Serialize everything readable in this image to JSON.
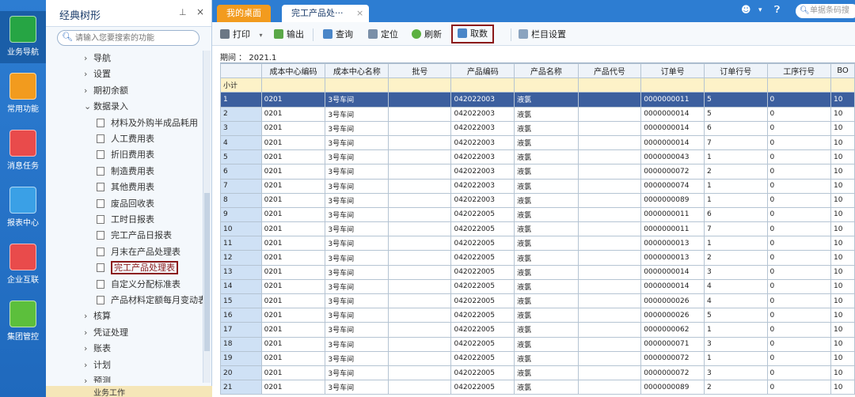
{
  "rail": [
    {
      "label": "业务导航",
      "icon": "nav-grid-icon",
      "color": "#26a544",
      "active": true
    },
    {
      "label": "常用功能",
      "icon": "star-icon",
      "color": "#f29b1e"
    },
    {
      "label": "消息任务",
      "icon": "message-icon",
      "color": "#e94b4b"
    },
    {
      "label": "报表中心",
      "icon": "report-icon",
      "color": "#3aa0e6"
    },
    {
      "label": "企业互联",
      "icon": "connect-icon",
      "color": "#e94b4b"
    },
    {
      "label": "集团管控",
      "icon": "group-icon",
      "color": "#5cbf3c"
    }
  ],
  "tree": {
    "title": "经典树形",
    "search_placeholder": "请输入您要搜索的功能",
    "items": [
      {
        "label": "导航",
        "level": 1,
        "arrow": "›"
      },
      {
        "label": "设置",
        "level": 1,
        "arrow": "›"
      },
      {
        "label": "期初余额",
        "level": 1,
        "arrow": "›"
      },
      {
        "label": "数据录入",
        "level": 1,
        "arrow": "⌄"
      },
      {
        "label": "材料及外购半成品耗用",
        "level": 2
      },
      {
        "label": "人工费用表",
        "level": 2
      },
      {
        "label": "折旧费用表",
        "level": 2
      },
      {
        "label": "制造费用表",
        "level": 2
      },
      {
        "label": "其他费用表",
        "level": 2
      },
      {
        "label": "废品回收表",
        "level": 2
      },
      {
        "label": "工时日报表",
        "level": 2
      },
      {
        "label": "完工产品日报表",
        "level": 2
      },
      {
        "label": "月末在产品处理表",
        "level": 2
      },
      {
        "label": "完工产品处理表",
        "level": 2,
        "selected": true
      },
      {
        "label": "自定义分配标准表",
        "level": 2
      },
      {
        "label": "产品材料定额每月变动表",
        "level": 2
      },
      {
        "label": "核算",
        "level": 1,
        "arrow": "›"
      },
      {
        "label": "凭证处理",
        "level": 1,
        "arrow": "›"
      },
      {
        "label": "账表",
        "level": 1,
        "arrow": "›"
      },
      {
        "label": "计划",
        "level": 1,
        "arrow": "›"
      },
      {
        "label": "预测",
        "level": 1,
        "arrow": "›"
      }
    ],
    "footer": "业务工作"
  },
  "tabs": {
    "home": "我的桌面",
    "current": "完工产品处···",
    "close": "×"
  },
  "top_search_placeholder": "单据条码搜",
  "toolbar": {
    "print": "打印",
    "export": "输出",
    "query": "查询",
    "locate": "定位",
    "refresh": "刷新",
    "fetch": "取数",
    "columns": "栏目设置"
  },
  "period": {
    "label": "期间",
    "value": "2021.1"
  },
  "grid": {
    "headers": [
      "成本中心编码",
      "成本中心名称",
      "批号",
      "产品编码",
      "产品名称",
      "产品代号",
      "订单号",
      "订单行号",
      "工序行号",
      "BO"
    ],
    "subtotal": "小计",
    "rows": [
      [
        "1",
        "0201",
        "3号车间",
        "",
        "042022003",
        "液氯",
        "",
        "0000000011",
        "5",
        "0",
        "10"
      ],
      [
        "2",
        "0201",
        "3号车间",
        "",
        "042022003",
        "液氯",
        "",
        "0000000014",
        "5",
        "0",
        "10"
      ],
      [
        "3",
        "0201",
        "3号车间",
        "",
        "042022003",
        "液氯",
        "",
        "0000000014",
        "6",
        "0",
        "10"
      ],
      [
        "4",
        "0201",
        "3号车间",
        "",
        "042022003",
        "液氯",
        "",
        "0000000014",
        "7",
        "0",
        "10"
      ],
      [
        "5",
        "0201",
        "3号车间",
        "",
        "042022003",
        "液氯",
        "",
        "0000000043",
        "1",
        "0",
        "10"
      ],
      [
        "6",
        "0201",
        "3号车间",
        "",
        "042022003",
        "液氯",
        "",
        "0000000072",
        "2",
        "0",
        "10"
      ],
      [
        "7",
        "0201",
        "3号车间",
        "",
        "042022003",
        "液氯",
        "",
        "0000000074",
        "1",
        "0",
        "10"
      ],
      [
        "8",
        "0201",
        "3号车间",
        "",
        "042022003",
        "液氯",
        "",
        "0000000089",
        "1",
        "0",
        "10"
      ],
      [
        "9",
        "0201",
        "3号车间",
        "",
        "042022005",
        "液氯",
        "",
        "0000000011",
        "6",
        "0",
        "10"
      ],
      [
        "10",
        "0201",
        "3号车间",
        "",
        "042022005",
        "液氯",
        "",
        "0000000011",
        "7",
        "0",
        "10"
      ],
      [
        "11",
        "0201",
        "3号车间",
        "",
        "042022005",
        "液氯",
        "",
        "0000000013",
        "1",
        "0",
        "10"
      ],
      [
        "12",
        "0201",
        "3号车间",
        "",
        "042022005",
        "液氯",
        "",
        "0000000013",
        "2",
        "0",
        "10"
      ],
      [
        "13",
        "0201",
        "3号车间",
        "",
        "042022005",
        "液氯",
        "",
        "0000000014",
        "3",
        "0",
        "10"
      ],
      [
        "14",
        "0201",
        "3号车间",
        "",
        "042022005",
        "液氯",
        "",
        "0000000014",
        "4",
        "0",
        "10"
      ],
      [
        "15",
        "0201",
        "3号车间",
        "",
        "042022005",
        "液氯",
        "",
        "0000000026",
        "4",
        "0",
        "10"
      ],
      [
        "16",
        "0201",
        "3号车间",
        "",
        "042022005",
        "液氯",
        "",
        "0000000026",
        "5",
        "0",
        "10"
      ],
      [
        "17",
        "0201",
        "3号车间",
        "",
        "042022005",
        "液氯",
        "",
        "0000000062",
        "1",
        "0",
        "10"
      ],
      [
        "18",
        "0201",
        "3号车间",
        "",
        "042022005",
        "液氯",
        "",
        "0000000071",
        "3",
        "0",
        "10"
      ],
      [
        "19",
        "0201",
        "3号车间",
        "",
        "042022005",
        "液氯",
        "",
        "0000000072",
        "1",
        "0",
        "10"
      ],
      [
        "20",
        "0201",
        "3号车间",
        "",
        "042022005",
        "液氯",
        "",
        "0000000072",
        "3",
        "0",
        "10"
      ],
      [
        "21",
        "0201",
        "3号车间",
        "",
        "042022005",
        "液氯",
        "",
        "0000000089",
        "2",
        "0",
        "10"
      ]
    ]
  }
}
